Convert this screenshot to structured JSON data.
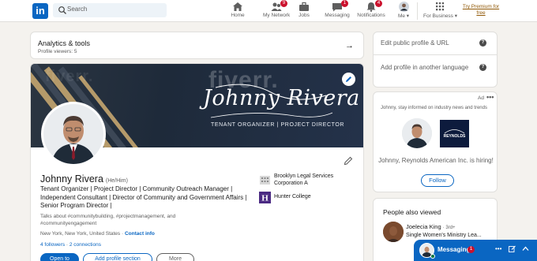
{
  "nav": {
    "logo": "in",
    "search_placeholder": "Search",
    "items": [
      {
        "label": "Home",
        "icon": "home-icon",
        "badge": ""
      },
      {
        "label": "My Network",
        "icon": "people-icon",
        "badge": "9"
      },
      {
        "label": "Jobs",
        "icon": "briefcase-icon",
        "badge": ""
      },
      {
        "label": "Messaging",
        "icon": "chat-icon",
        "badge": "1"
      },
      {
        "label": "Notifications",
        "icon": "bell-icon",
        "badge": "4"
      },
      {
        "label": "Me ▾",
        "icon": "avatar",
        "badge": ""
      },
      {
        "label": "For Business ▾",
        "icon": "grid-icon",
        "badge": ""
      }
    ],
    "premium": "Try Premium for free"
  },
  "analytics": {
    "title": "Analytics & tools",
    "subtitle": "Profile viewers: 5",
    "arrow": "→"
  },
  "profile": {
    "banner": {
      "watermark": "fiverr.",
      "signature": "Johnny Rivera",
      "tagline": "TENANT ORGANIZER | PROJECT DIRECTOR"
    },
    "name": "Johnny Rivera",
    "pronouns": "(He/Him)",
    "headline": "Tenant Organizer | Project Director | Community Outreach Manager | Independent Consultant | Director of Community and Government Affairs | Senior Program Director |",
    "talks_about": "Talks about #communitybuilding, #projectmanagement, and #communityengagement",
    "location": "New York, New York, United States",
    "contact_info": "Contact info",
    "followers": "4 followers",
    "connections": "2 connections",
    "buttons": {
      "open_to": "Open to",
      "add_section": "Add profile section",
      "more": "More"
    },
    "orgs": [
      {
        "name": "Brooklyn Legal Services Corporation A",
        "logo": "building-icon"
      },
      {
        "name": "Hunter College",
        "logo": "hunter-logo"
      }
    ]
  },
  "sidebar": {
    "edit_url": "Edit public profile & URL",
    "add_language": "Add profile in another language",
    "help": "?",
    "ad": {
      "label": "Ad",
      "menu": "•••",
      "message": "Johnny, stay informed on industry news and trends",
      "company_logo_text": "REYNOLDS",
      "cta": "Johnny, Reynolds American Inc. is hiring!",
      "follow": "Follow"
    },
    "people_also_viewed": {
      "heading": "People also viewed",
      "people": [
        {
          "name": "Joelecia King",
          "degree": "· 3rd+",
          "title": "Single Women's Ministry Lea..."
        }
      ]
    }
  },
  "messaging": {
    "label": "Messaging",
    "badge": "1"
  },
  "colors": {
    "linkedin_blue": "#0a66c2",
    "badge_red": "#cb112d",
    "premium_gold": "#915907",
    "banner_navy": "#1e2a3a"
  }
}
